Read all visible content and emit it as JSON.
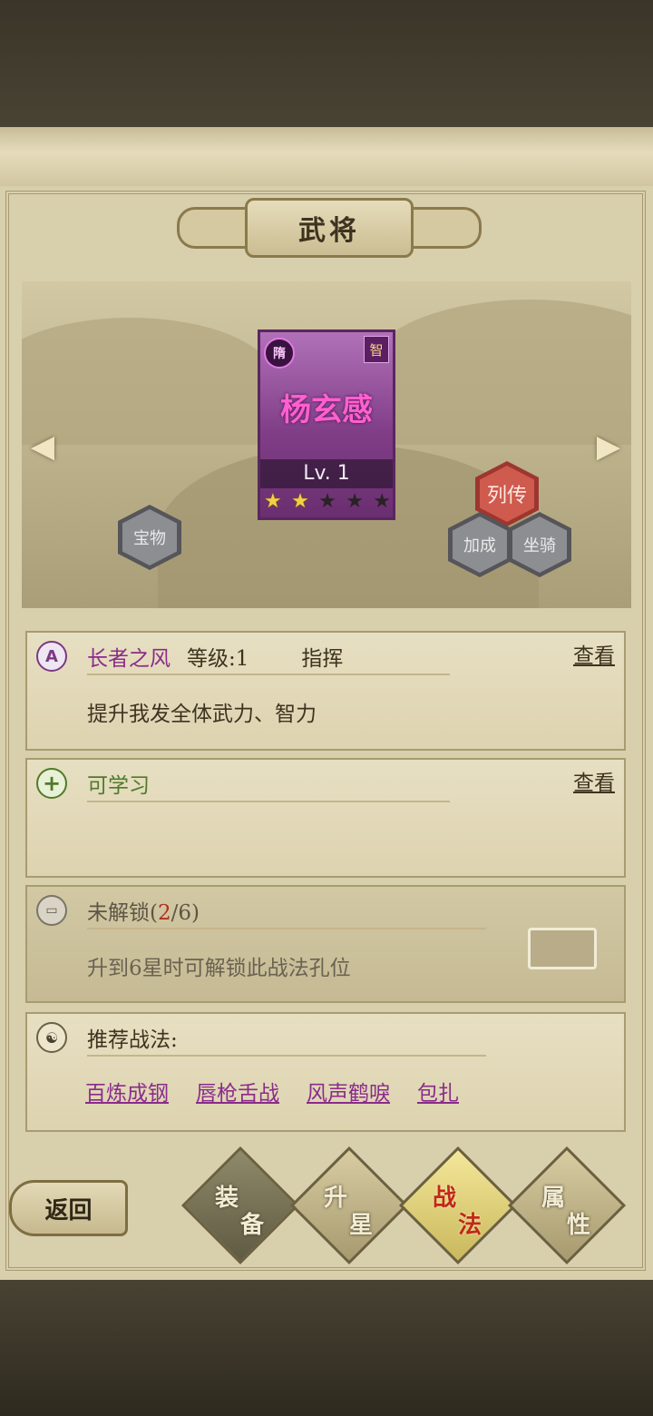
{
  "header": {
    "title": "武将"
  },
  "hero": {
    "name": "杨玄感",
    "faction": "隋",
    "type": "智",
    "level": "Lv. 1",
    "stars_total": 5,
    "stars_filled": 2
  },
  "side_badges": {
    "treasure": [
      "宝",
      "物"
    ],
    "biography": [
      "列",
      "传"
    ],
    "bonus": [
      "加",
      "成"
    ],
    "mount": [
      "坐",
      "骑"
    ]
  },
  "skills": {
    "main": {
      "badge": "A",
      "name": "长者之风",
      "level": "等级:1",
      "type": "指挥",
      "view": "查看",
      "desc": "提升我发全体武力、智力"
    },
    "learnable": {
      "badge": "+",
      "label": "可学习",
      "view": "查看"
    },
    "locked": {
      "label_prefix": "未解锁(",
      "unlocked": "2",
      "label_suffix": "/6)",
      "desc": "升到6星时可解锁此战法孔位"
    },
    "recommend": {
      "label": "推荐战法:",
      "tactics": [
        "百炼成钢",
        "唇枪舌战",
        "风声鹤唳",
        "包扎"
      ]
    }
  },
  "nav": {
    "back": "返回",
    "tabs": [
      {
        "c1": "装",
        "c2": "备"
      },
      {
        "c1": "升",
        "c2": "星"
      },
      {
        "c1": "战",
        "c2": "法"
      },
      {
        "c1": "属",
        "c2": "性"
      }
    ],
    "active_tab": 2
  },
  "colors": {
    "card_purple": "#7f3d86",
    "name_pink": "#ff5fd0",
    "skill_name": "#8a2c8a",
    "learn_green": "#4f7a2c",
    "locked_red": "#b03020"
  }
}
